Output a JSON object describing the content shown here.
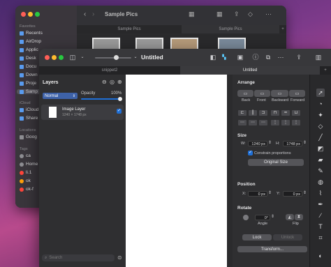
{
  "finder": {
    "title": "Sample Pics",
    "tabs": [
      "Sample Pics",
      "Sample Pics"
    ],
    "sections": {
      "favorites": "Favorites",
      "icloud": "iCloud",
      "locations": "Locations",
      "tags": "Tags"
    },
    "favorites": [
      "Recents",
      "AirDrop",
      "Applic",
      "Desk",
      "Docu",
      "Down",
      "Proje",
      "Samp"
    ],
    "icloud_items": [
      "iCloud",
      "Share"
    ],
    "location_items": [
      "Goog"
    ],
    "tag_items": [
      {
        "label": "ca",
        "color": "#8e8e93"
      },
      {
        "label": "Home",
        "color": "#8e8e93"
      },
      {
        "label": "li.1",
        "color": "#ff453a"
      },
      {
        "label": "ok",
        "color": "#ff9f0a"
      },
      {
        "label": "ok-f",
        "color": "#ff453a"
      }
    ]
  },
  "app": {
    "title": "Untitled",
    "tabs": [
      "snippet2",
      "Untitled"
    ],
    "layers": {
      "heading": "Layers",
      "blend_mode": "Normal",
      "opacity_label": "Opacity",
      "opacity_value": "100%",
      "opacity_fraction": 1.0,
      "layer_name": "Image Layer",
      "layer_size": "1240 × 1748 px",
      "layer_checked": true,
      "search_placeholder": "Search"
    },
    "arrange": {
      "heading": "Arrange",
      "order_buttons": [
        "Back",
        "Front",
        "Backward",
        "Forward"
      ],
      "size_heading": "Size",
      "w_label": "W:",
      "w_value": "1240 px",
      "h_label": "H:",
      "h_value": "1748 px",
      "constrain_label": "Constrain proportions",
      "constrain_checked": true,
      "original_size_button": "Original Size",
      "position_heading": "Position",
      "x_label": "X:",
      "x_value": "0 px",
      "y_label": "Y:",
      "y_value": "0 px",
      "rotate_heading": "Rotate",
      "angle_value": "0°",
      "angle_label": "Angle",
      "flip_label": "Flip",
      "lock_button": "Lock",
      "unlock_button": "Unlock",
      "transform_button": "Transform..."
    },
    "accent": "#1f6fd6"
  }
}
